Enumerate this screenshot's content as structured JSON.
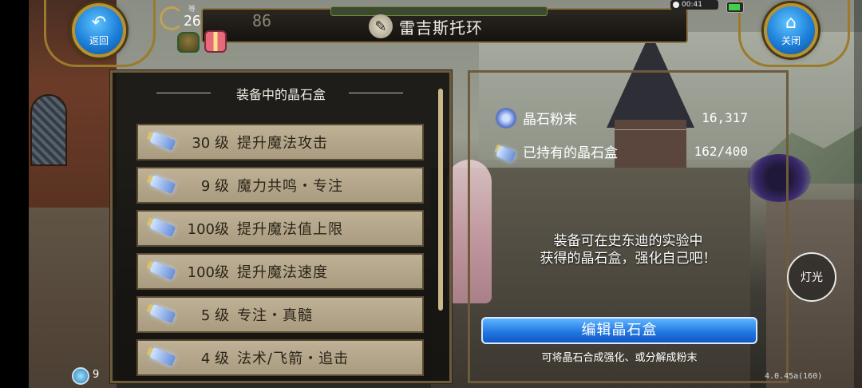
{
  "header": {
    "title": "雷吉斯托环",
    "title_icon": "staff-emblem-icon",
    "bg_number": "86"
  },
  "nav": {
    "back_label": "返回",
    "close_label": "关闭"
  },
  "player": {
    "level_caption": "等",
    "level": "26"
  },
  "status": {
    "time": "00:41"
  },
  "left_panel": {
    "title": "装备中的晶石盒",
    "items": [
      {
        "level": "30 级",
        "name": "提升魔法攻击"
      },
      {
        "level": "9 级",
        "name": "魔力共鸣・专注"
      },
      {
        "level": "100级",
        "name": "提升魔法值上限"
      },
      {
        "level": "100级",
        "name": "提升魔法速度"
      },
      {
        "level": "5 级",
        "name": "专注・真髓"
      },
      {
        "level": "4 级",
        "name": "法术/飞箭・追击"
      }
    ]
  },
  "right_panel": {
    "stats": [
      {
        "label": "晶石粉末",
        "value": "16,317"
      },
      {
        "label": "已持有的晶石盒",
        "value": "162/400"
      }
    ],
    "hint_line1": "装备可在史东迪的实验中",
    "hint_line2": "获得的晶石盒，强化自己吧！",
    "edit_button": "编辑晶石盒",
    "edit_sub": "可将晶石合成强化、或分解成粉末"
  },
  "light_button": "灯光",
  "bottom": {
    "left_text": "9",
    "version": "4.0.45a(160)"
  },
  "colors": {
    "accent_blue": "#1f74e0",
    "gold_border": "#b8922e",
    "item_bg": "#bfb196"
  }
}
